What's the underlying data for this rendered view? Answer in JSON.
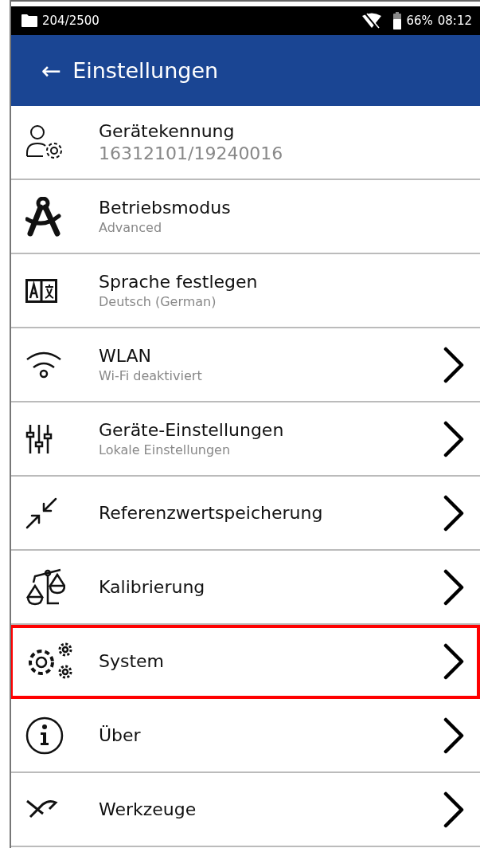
{
  "status_bar": {
    "storage": "204/2500",
    "battery": "66%",
    "time": "08:12"
  },
  "header": {
    "back": "←",
    "title": "Einstellungen"
  },
  "items": [
    {
      "title": "Gerätekennung",
      "subtitle": "16312101/19240016",
      "chevron": false,
      "selected": false
    },
    {
      "title": "Betriebsmodus",
      "subtitle": "Advanced",
      "chevron": false,
      "selected": false
    },
    {
      "title": "Sprache festlegen",
      "subtitle": "Deutsch (German)",
      "chevron": false,
      "selected": false
    },
    {
      "title": "WLAN",
      "subtitle": "Wi-Fi deaktiviert",
      "chevron": true,
      "selected": false
    },
    {
      "title": "Geräte-Einstellungen",
      "subtitle": "Lokale Einstellungen",
      "chevron": true,
      "selected": false
    },
    {
      "title": "Referenzwertspeicherung",
      "chevron": true,
      "selected": false
    },
    {
      "title": "Kalibrierung",
      "chevron": true,
      "selected": false
    },
    {
      "title": "System",
      "chevron": true,
      "selected": true
    },
    {
      "title": "Über",
      "chevron": true,
      "selected": false
    },
    {
      "title": "Werkzeuge",
      "chevron": true,
      "selected": false
    }
  ]
}
